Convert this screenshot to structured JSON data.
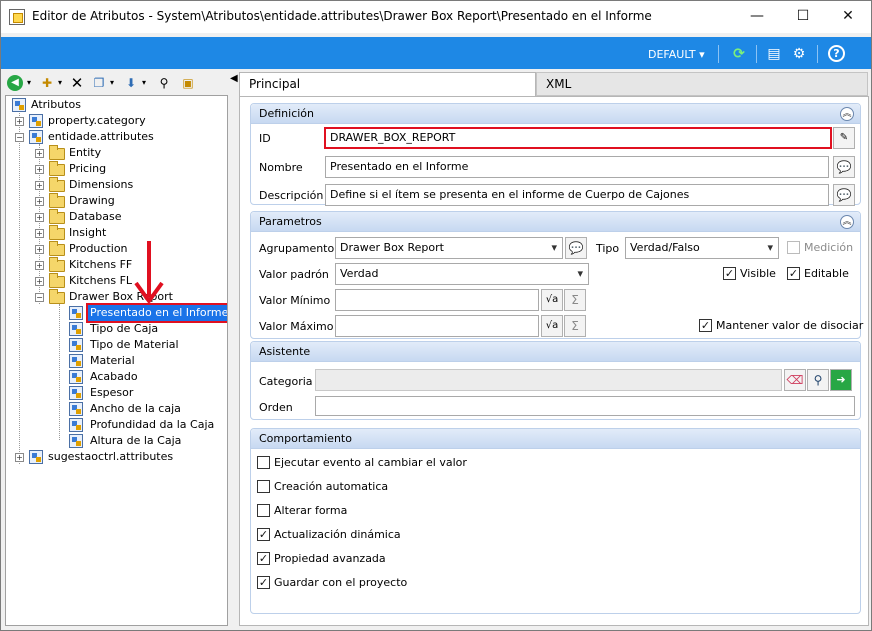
{
  "window": {
    "title": "Editor de Atributos - System\\Atributos\\entidade.attributes\\Drawer Box Report\\Presentado en el Informe",
    "minimize": "—",
    "maximize": "☐",
    "close": "✕"
  },
  "toolbar": {
    "preset": "DEFAULT",
    "icons": [
      "refresh-icon",
      "layout-icon",
      "settings-icon",
      "help-icon"
    ]
  },
  "tree": {
    "root": "Atributos",
    "nodes": {
      "property_category": "property.category",
      "entidade_attributes": "entidade.attributes",
      "entity": "Entity",
      "pricing": "Pricing",
      "dimensions": "Dimensions",
      "drawing": "Drawing",
      "database": "Database",
      "insight": "Insight",
      "production": "Production",
      "kitchens_ff": "Kitchens FF",
      "kitchens_fl": "Kitchens FL",
      "drawer_box_report": "Drawer Box Report",
      "presentado": "Presentado en el Informe",
      "tipo_caja": "Tipo de Caja",
      "tipo_material": "Tipo de Material",
      "material": "Material",
      "acabado": "Acabado",
      "espesor": "Espesor",
      "ancho": "Ancho de la caja",
      "profundidad": "Profundidad da la Caja",
      "altura": "Altura de la Caja",
      "sugestaoctrl": "sugestaoctrl.attributes"
    }
  },
  "tabs": {
    "principal": "Principal",
    "xml": "XML"
  },
  "definicion": {
    "header": "Definición",
    "id_label": "ID",
    "id_value": "DRAWER_BOX_REPORT",
    "nombre_label": "Nombre",
    "nombre_value": "Presentado en el Informe",
    "descripcion_label": "Descripción",
    "descripcion_value": "Define si el ítem se presenta en el informe de Cuerpo de Cajones"
  },
  "parametros": {
    "header": "Parametros",
    "agrupamento_label": "Agrupamento",
    "agrupamento_value": "Drawer Box Report",
    "tipo_label": "Tipo",
    "tipo_value": "Verdad/Falso",
    "medicion_label": "Medición",
    "valor_padron_label": "Valor padrón",
    "valor_padron_value": "Verdad",
    "visible_label": "Visible",
    "editable_label": "Editable",
    "valor_minimo_label": "Valor Mínimo",
    "valor_minimo_value": "",
    "valor_maximo_label": "Valor Máximo",
    "valor_maximo_value": "",
    "mantener_label": "Mantener valor de disociar",
    "medicion_checked": false,
    "visible_checked": true,
    "editable_checked": true,
    "mantener_checked": true
  },
  "asistente": {
    "header": "Asistente",
    "categoria_label": "Categoria",
    "categoria_value": "",
    "orden_label": "Orden",
    "orden_value": ""
  },
  "comportamiento": {
    "header": "Comportamiento",
    "items": [
      {
        "label": "Ejecutar evento al cambiar el valor",
        "checked": false
      },
      {
        "label": "Creación automatica",
        "checked": false
      },
      {
        "label": "Alterar forma",
        "checked": false
      },
      {
        "label": "Actualización dinámica",
        "checked": true
      },
      {
        "label": "Propiedad avanzada",
        "checked": true
      },
      {
        "label": "Guardar con el proyecto",
        "checked": true
      }
    ]
  },
  "colors": {
    "accent": "#1e88e5",
    "highlight": "#e01020",
    "selection": "#1a73e8"
  }
}
